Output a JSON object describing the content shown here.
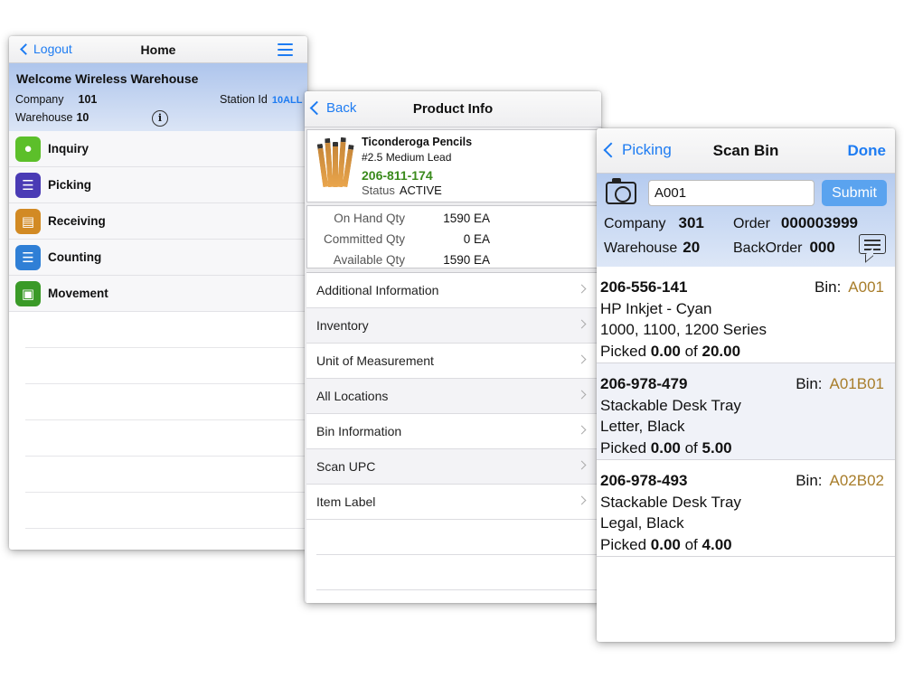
{
  "home": {
    "nav": {
      "back_label": "Logout",
      "title": "Home",
      "menu_icon": "hamburger-icon"
    },
    "welcome": {
      "title": "Welcome Wireless Warehouse",
      "company_label": "Company",
      "company_value": "101",
      "station_label": "Station Id",
      "station_value": "10ALL",
      "warehouse_label": "Warehouse",
      "warehouse_value": "10"
    },
    "menu": [
      {
        "label": "Inquiry",
        "icon": "tag-icon",
        "color": "#5cbf2a"
      },
      {
        "label": "Picking",
        "icon": "list-icon",
        "color": "#4a3bb5"
      },
      {
        "label": "Receiving",
        "icon": "clipboard-icon",
        "color": "#d28a24"
      },
      {
        "label": "Counting",
        "icon": "numbered-list-icon",
        "color": "#2f7fd6"
      },
      {
        "label": "Movement",
        "icon": "hand-truck-icon",
        "color": "#3a9a28"
      }
    ]
  },
  "product_info": {
    "nav": {
      "back_label": "Back",
      "title": "Product Info"
    },
    "product": {
      "name": "Ticonderoga Pencils",
      "description": "#2.5 Medium Lead",
      "number": "206-811-174",
      "status_label": "Status",
      "status_value": "ACTIVE"
    },
    "quantities": [
      {
        "label": "On Hand Qty",
        "value": "1590 EA"
      },
      {
        "label": "Committed Qty",
        "value": "0 EA"
      },
      {
        "label": "Available Qty",
        "value": "1590 EA"
      }
    ],
    "menu": [
      "Additional Information",
      "Inventory",
      "Unit of Measurement",
      "All Locations",
      "Bin Information",
      "Scan UPC",
      "Item Label"
    ]
  },
  "scan_bin": {
    "nav": {
      "back_label": "Picking",
      "title": "Scan Bin",
      "done_label": "Done"
    },
    "bin_input_value": "A001",
    "submit_label": "Submit",
    "company_label": "Company",
    "company_value": "301",
    "order_label": "Order",
    "order_value": "000003999",
    "warehouse_label": "Warehouse",
    "warehouse_value": "20",
    "backorder_label": "BackOrder",
    "backorder_value": "000",
    "bin_label": "Bin:",
    "picked_label": "Picked",
    "of_label": "of",
    "items": [
      {
        "number": "206-556-141",
        "bin": "A001",
        "line1": "HP Inkjet - Cyan",
        "line2": "1000, 1100, 1200 Series",
        "picked": "0.00",
        "total": "20.00"
      },
      {
        "number": "206-978-479",
        "bin": "A01B01",
        "line1": "Stackable Desk Tray",
        "line2": "Letter, Black",
        "picked": "0.00",
        "total": "5.00"
      },
      {
        "number": "206-978-493",
        "bin": "A02B02",
        "line1": "Stackable Desk Tray",
        "line2": "Legal, Black",
        "picked": "0.00",
        "total": "4.00"
      }
    ]
  },
  "colors": {
    "accent": "#1e7cf2",
    "header_blue": "#b5cbef",
    "item_number_green": "#3a8a1c",
    "bin_gold": "#a87d2a",
    "submit_blue": "#5aa3ef"
  }
}
